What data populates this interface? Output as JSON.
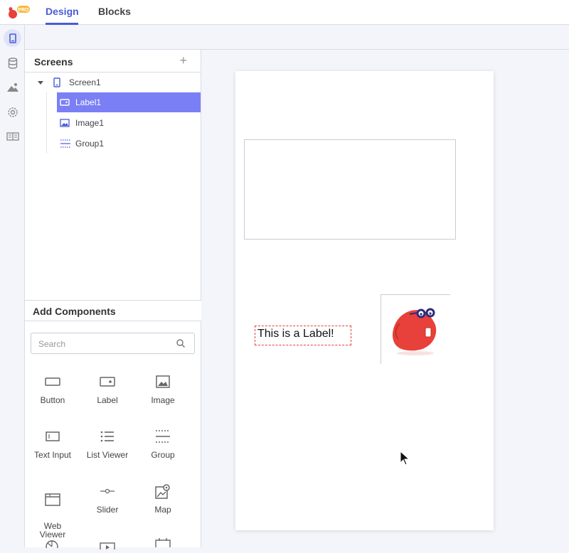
{
  "app": {
    "badge": "PRO"
  },
  "tabs": [
    {
      "label": "Design",
      "active": true
    },
    {
      "label": "Blocks",
      "active": false
    }
  ],
  "rail": {
    "icons": [
      "screen-icon",
      "database-icon",
      "media-icon",
      "settings-icon",
      "docs-icon"
    ],
    "active": "screen-icon"
  },
  "screens_panel": {
    "title": "Screens",
    "add_icon": "plus-icon",
    "tree": [
      {
        "label": "Screen1",
        "icon": "phone-icon",
        "level": 0,
        "expanded": true,
        "selected": false
      },
      {
        "label": "Label1",
        "icon": "label-icon",
        "level": 1,
        "selected": true
      },
      {
        "label": "Image1",
        "icon": "image-icon",
        "level": 1,
        "selected": false
      },
      {
        "label": "Group1",
        "icon": "group-icon",
        "level": 1,
        "selected": false
      }
    ]
  },
  "add_components": {
    "title": "Add Components",
    "search_placeholder": "Search",
    "search_value": "",
    "items": [
      {
        "label": "Button",
        "icon": "button-icon"
      },
      {
        "label": "Label",
        "icon": "label-icon"
      },
      {
        "label": "Image",
        "icon": "image-icon"
      },
      {
        "label": "Text Input",
        "icon": "text-input-icon"
      },
      {
        "label": "List Viewer",
        "icon": "list-viewer-icon"
      },
      {
        "label": "Group",
        "icon": "group-icon"
      },
      {
        "label": "Web\nViewer",
        "icon": "web-viewer-icon"
      },
      {
        "label": "Slider",
        "icon": "slider-icon"
      },
      {
        "label": "Map",
        "icon": "map-icon"
      }
    ]
  },
  "canvas": {
    "label_text": "This is a Label!",
    "image_icon": "mascot-image"
  },
  "colors": {
    "accent": "#4a5bd6",
    "selected_row": "#7b7ff5",
    "label_border": "#e0413a",
    "mascot": "#e8403a",
    "pro_badge": "#f6b93b"
  }
}
